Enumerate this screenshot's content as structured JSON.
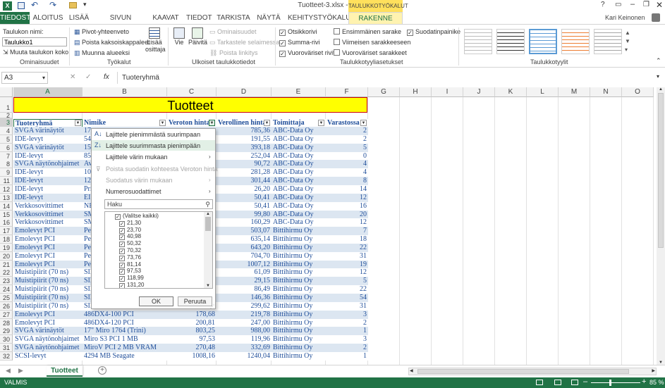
{
  "window": {
    "title": "Tuotteet-3.xlsx - Excel",
    "context_tab": "TAULUKKOTYÖKALUT",
    "user": "Kari Keinonen"
  },
  "tabs": [
    "TIEDOSTO",
    "ALOITUS",
    "LISÄÄ",
    "SIVUN ASETTELU",
    "KAAVAT",
    "TIEDOT",
    "TARKISTA",
    "NÄYTÄ",
    "KEHITYSTYÖKALUT",
    "RAKENNE"
  ],
  "ribbon": {
    "table_name_label": "Taulukon nimi:",
    "table_name_value": "Taulukko1",
    "resize": "Muuta taulukon koko",
    "pivot": "Pivot-yhteenveto",
    "remove_dup": "Poista kaksoiskappaleet",
    "convert": "Muunna alueeksi",
    "slicer": "Lisää osittaja",
    "export": "Vie",
    "refresh": "Päivitä",
    "properties": "Ominaisuudet",
    "open_browser": "Tarkastele selaimessa",
    "unlink": "Poista linkitys",
    "header_row": "Otsikkorivi",
    "total_row": "Summa-rivi",
    "banded_rows": "Vuoroväriset rivit",
    "first_col": "Ensimmäinen sarake",
    "last_col": "Viimeisen sarakkeeseen",
    "banded_cols": "Vuoroväriset sarakkeet",
    "filter_btn": "Suodatinpainike",
    "groups": [
      "Ominaisuudet",
      "Työkalut",
      "Ulkoiset taulukkotiedot",
      "Taulukkotyyliasetukset",
      "Taulukkotyylit"
    ]
  },
  "formula": {
    "namebox": "A3",
    "content": "Tuoteryhmä"
  },
  "columns": [
    "A",
    "B",
    "C",
    "D",
    "E",
    "F",
    "G",
    "H",
    "I",
    "J",
    "K",
    "L",
    "M",
    "N",
    "O"
  ],
  "title_cell": "Tuotteet",
  "headers": [
    "Tuoteryhmä",
    "Nimike",
    "Veroton hinta",
    "Verollinen hinta",
    "Toimittaja",
    "Varastossa"
  ],
  "rows": [
    {
      "n": "4",
      "a": "SVGA värinäytöt",
      "b": "17",
      "c": "",
      "d": "785,36",
      "e": "ABC-Data Oy",
      "f": "2"
    },
    {
      "n": "5",
      "a": "IDE-levyt",
      "b": "54",
      "c": "",
      "d": "191,55",
      "e": "ABC-Data Oy",
      "f": "2"
    },
    {
      "n": "6",
      "a": "SVGA värinäytöt",
      "b": "15",
      "c": "",
      "d": "393,18",
      "e": "ABC-Data Oy",
      "f": "5"
    },
    {
      "n": "7",
      "a": "IDE-levyt",
      "b": "85",
      "c": "",
      "d": "252,04",
      "e": "ABC-Data Oy",
      "f": "0"
    },
    {
      "n": "8",
      "a": "SVGA näytönohjaimet",
      "b": "Av",
      "c": "",
      "d": "90,72",
      "e": "ABC-Data Oy",
      "f": "4"
    },
    {
      "n": "9",
      "a": "IDE-levyt",
      "b": "10",
      "c": "",
      "d": "281,28",
      "e": "ABC-Data Oy",
      "f": "4"
    },
    {
      "n": "11",
      "a": "IDE-levyt",
      "b": "12",
      "c": "",
      "d": "301,44",
      "e": "ABC-Data Oy",
      "f": "8"
    },
    {
      "n": "12",
      "a": "IDE-levyt",
      "b": "Pri",
      "c": "",
      "d": "26,20",
      "e": "ABC-Data Oy",
      "f": "14"
    },
    {
      "n": "13",
      "a": "IDE-levyt",
      "b": "EI",
      "c": "",
      "d": "50,41",
      "e": "ABC-Data Oy",
      "f": "12"
    },
    {
      "n": "14",
      "a": "Verkkosovittimet",
      "b": "NE",
      "c": "",
      "d": "50,41",
      "e": "ABC-Data Oy",
      "f": "16"
    },
    {
      "n": "15",
      "a": "Verkkosovittimet",
      "b": "SM",
      "c": "",
      "d": "99,80",
      "e": "ABC-Data Oy",
      "f": "20"
    },
    {
      "n": "16",
      "a": "Verkkosovittimet",
      "b": "SM",
      "c": "",
      "d": "160,29",
      "e": "ABC-Data Oy",
      "f": "12"
    },
    {
      "n": "17",
      "a": "Emolevyt PCI",
      "b": "Per",
      "c": "",
      "d": "503,07",
      "e": "Bittihirmu Oy",
      "f": "7"
    },
    {
      "n": "18",
      "a": "Emolevyt PCI",
      "b": "Per",
      "c": "",
      "d": "635,14",
      "e": "Bittihirmu Oy",
      "f": "18"
    },
    {
      "n": "19",
      "a": "Emolevyt PCI",
      "b": "Per",
      "c": "",
      "d": "643,20",
      "e": "Bittihirmu Oy",
      "f": "22"
    },
    {
      "n": "20",
      "a": "Emolevyt PCI",
      "b": "Per",
      "c": "",
      "d": "704,70",
      "e": "Bittihirmu Oy",
      "f": "31"
    },
    {
      "n": "21",
      "a": "Emolevyt PCI",
      "b": "Per",
      "c": "",
      "d": "1007,12",
      "e": "Bittihirmu Oy",
      "f": "19"
    },
    {
      "n": "22",
      "a": "Muistipiirit (70 ns)",
      "b": "SIN",
      "c": "",
      "d": "61,09",
      "e": "Bittihirmu Oy",
      "f": "12"
    },
    {
      "n": "23",
      "a": "Muistipiirit (70 ns)",
      "b": "SIN",
      "c": "",
      "d": "29,15",
      "e": "Bittihirmu Oy",
      "f": "5"
    },
    {
      "n": "24",
      "a": "Muistipiirit (70 ns)",
      "b": "SIN",
      "c": "",
      "d": "86,49",
      "e": "Bittihirmu Oy",
      "f": "22"
    },
    {
      "n": "25",
      "a": "Muistipiirit (70 ns)",
      "b": "SIN",
      "c": "",
      "d": "146,36",
      "e": "Bittihirmu Oy",
      "f": "54"
    },
    {
      "n": "26",
      "a": "Muistipiirit (70 ns)",
      "b": "SIN",
      "c": "",
      "d": "299,62",
      "e": "Bittihirmu Oy",
      "f": "31"
    },
    {
      "n": "27",
      "a": "Emolevyt PCI",
      "b": "486DX4-100 PCI",
      "c": "178,68",
      "d": "219,78",
      "e": "Bittihirmu Oy",
      "f": "3"
    },
    {
      "n": "28",
      "a": "Emolevyt PCI",
      "b": "486DX4-120 PCI",
      "c": "200,81",
      "d": "247,00",
      "e": "Bittihirmu Oy",
      "f": "2"
    },
    {
      "n": "29",
      "a": "SVGA värinäytöt",
      "b": "17\" Miro 1764 (Trini)",
      "c": "803,25",
      "d": "988,00",
      "e": "Bittihirmu Oy",
      "f": "1"
    },
    {
      "n": "30",
      "a": "SVGA näytönohjaimet",
      "b": "Miro S3 PCI 1 MB",
      "c": "97,53",
      "d": "119,96",
      "e": "Bittihirmu Oy",
      "f": "3"
    },
    {
      "n": "31",
      "a": "SVGA näytönohjaimet",
      "b": "MiroV PCI 2 MB VRAM",
      "c": "270,48",
      "d": "332,69",
      "e": "Bittihirmu Oy",
      "f": "2"
    },
    {
      "n": "32",
      "a": "SCSI-levyt",
      "b": "4294 MB Seagate",
      "c": "1008,16",
      "d": "1240,04",
      "e": "Bittihirmu Oy",
      "f": "1"
    }
  ],
  "filter_menu": {
    "sort_asc": "Lajittele pienimmästä suurimpaan",
    "sort_desc": "Lajittele suurimmasta pienimpään",
    "sort_color": "Lajittele värin mukaan",
    "clear": "Poista suodatin kohteesta Veroton hinta",
    "filter_color": "Suodatus värin mukaan",
    "number_filters": "Numerosuodattimet",
    "search_placeholder": "Haku",
    "items": [
      "(Valitse kaikki)",
      "21,30",
      "23,70",
      "40,98",
      "50,32",
      "70,32",
      "73,76",
      "81,14",
      "97,53",
      "118,99",
      "131,20"
    ],
    "ok": "OK",
    "cancel": "Peruuta"
  },
  "sheet_tab": "Tuotteet",
  "status": {
    "mode": "VALMIS",
    "zoom": "85 %"
  },
  "colors": {
    "excel_green": "#217346",
    "table_header": "#1f4e9a",
    "title_fill": "#ffff00",
    "band": "#dce6f1"
  }
}
